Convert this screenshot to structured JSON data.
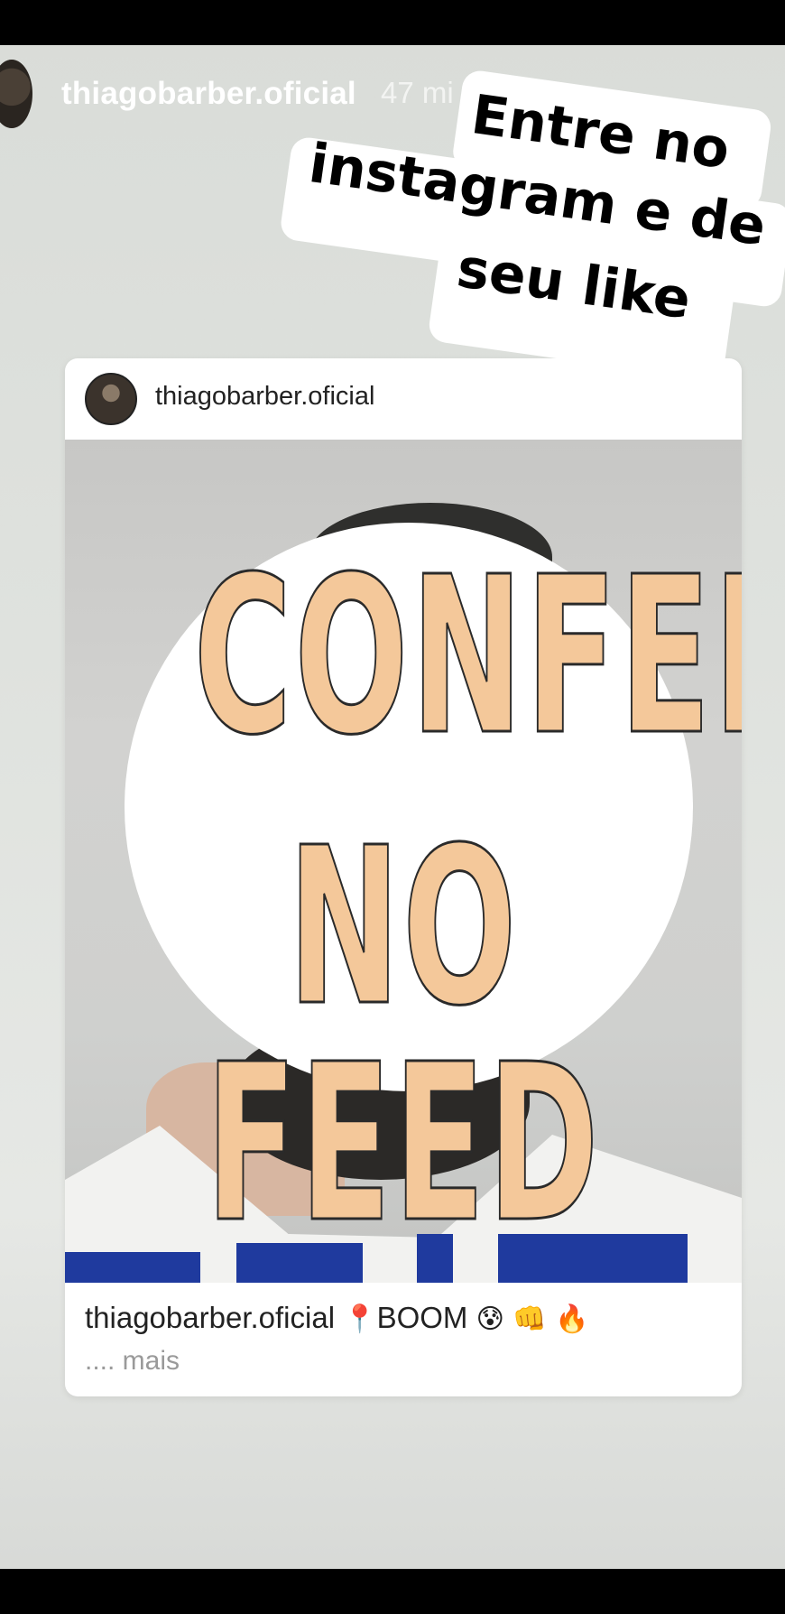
{
  "story": {
    "username": "thiagobarber.oficial",
    "time": "47 mi"
  },
  "sticker": {
    "line1": "Entre no",
    "line2": "instagram e de",
    "line3": "seu like"
  },
  "post": {
    "username": "thiagobarber.oficial",
    "overlay_line1": "CONFERE",
    "overlay_line2": "NO FEED",
    "caption_user": "thiagobarber.oficial",
    "caption_pin": "📍",
    "caption_text": "BOOM",
    "caption_emojis": "😰 👊 🔥",
    "more": ".... mais"
  }
}
